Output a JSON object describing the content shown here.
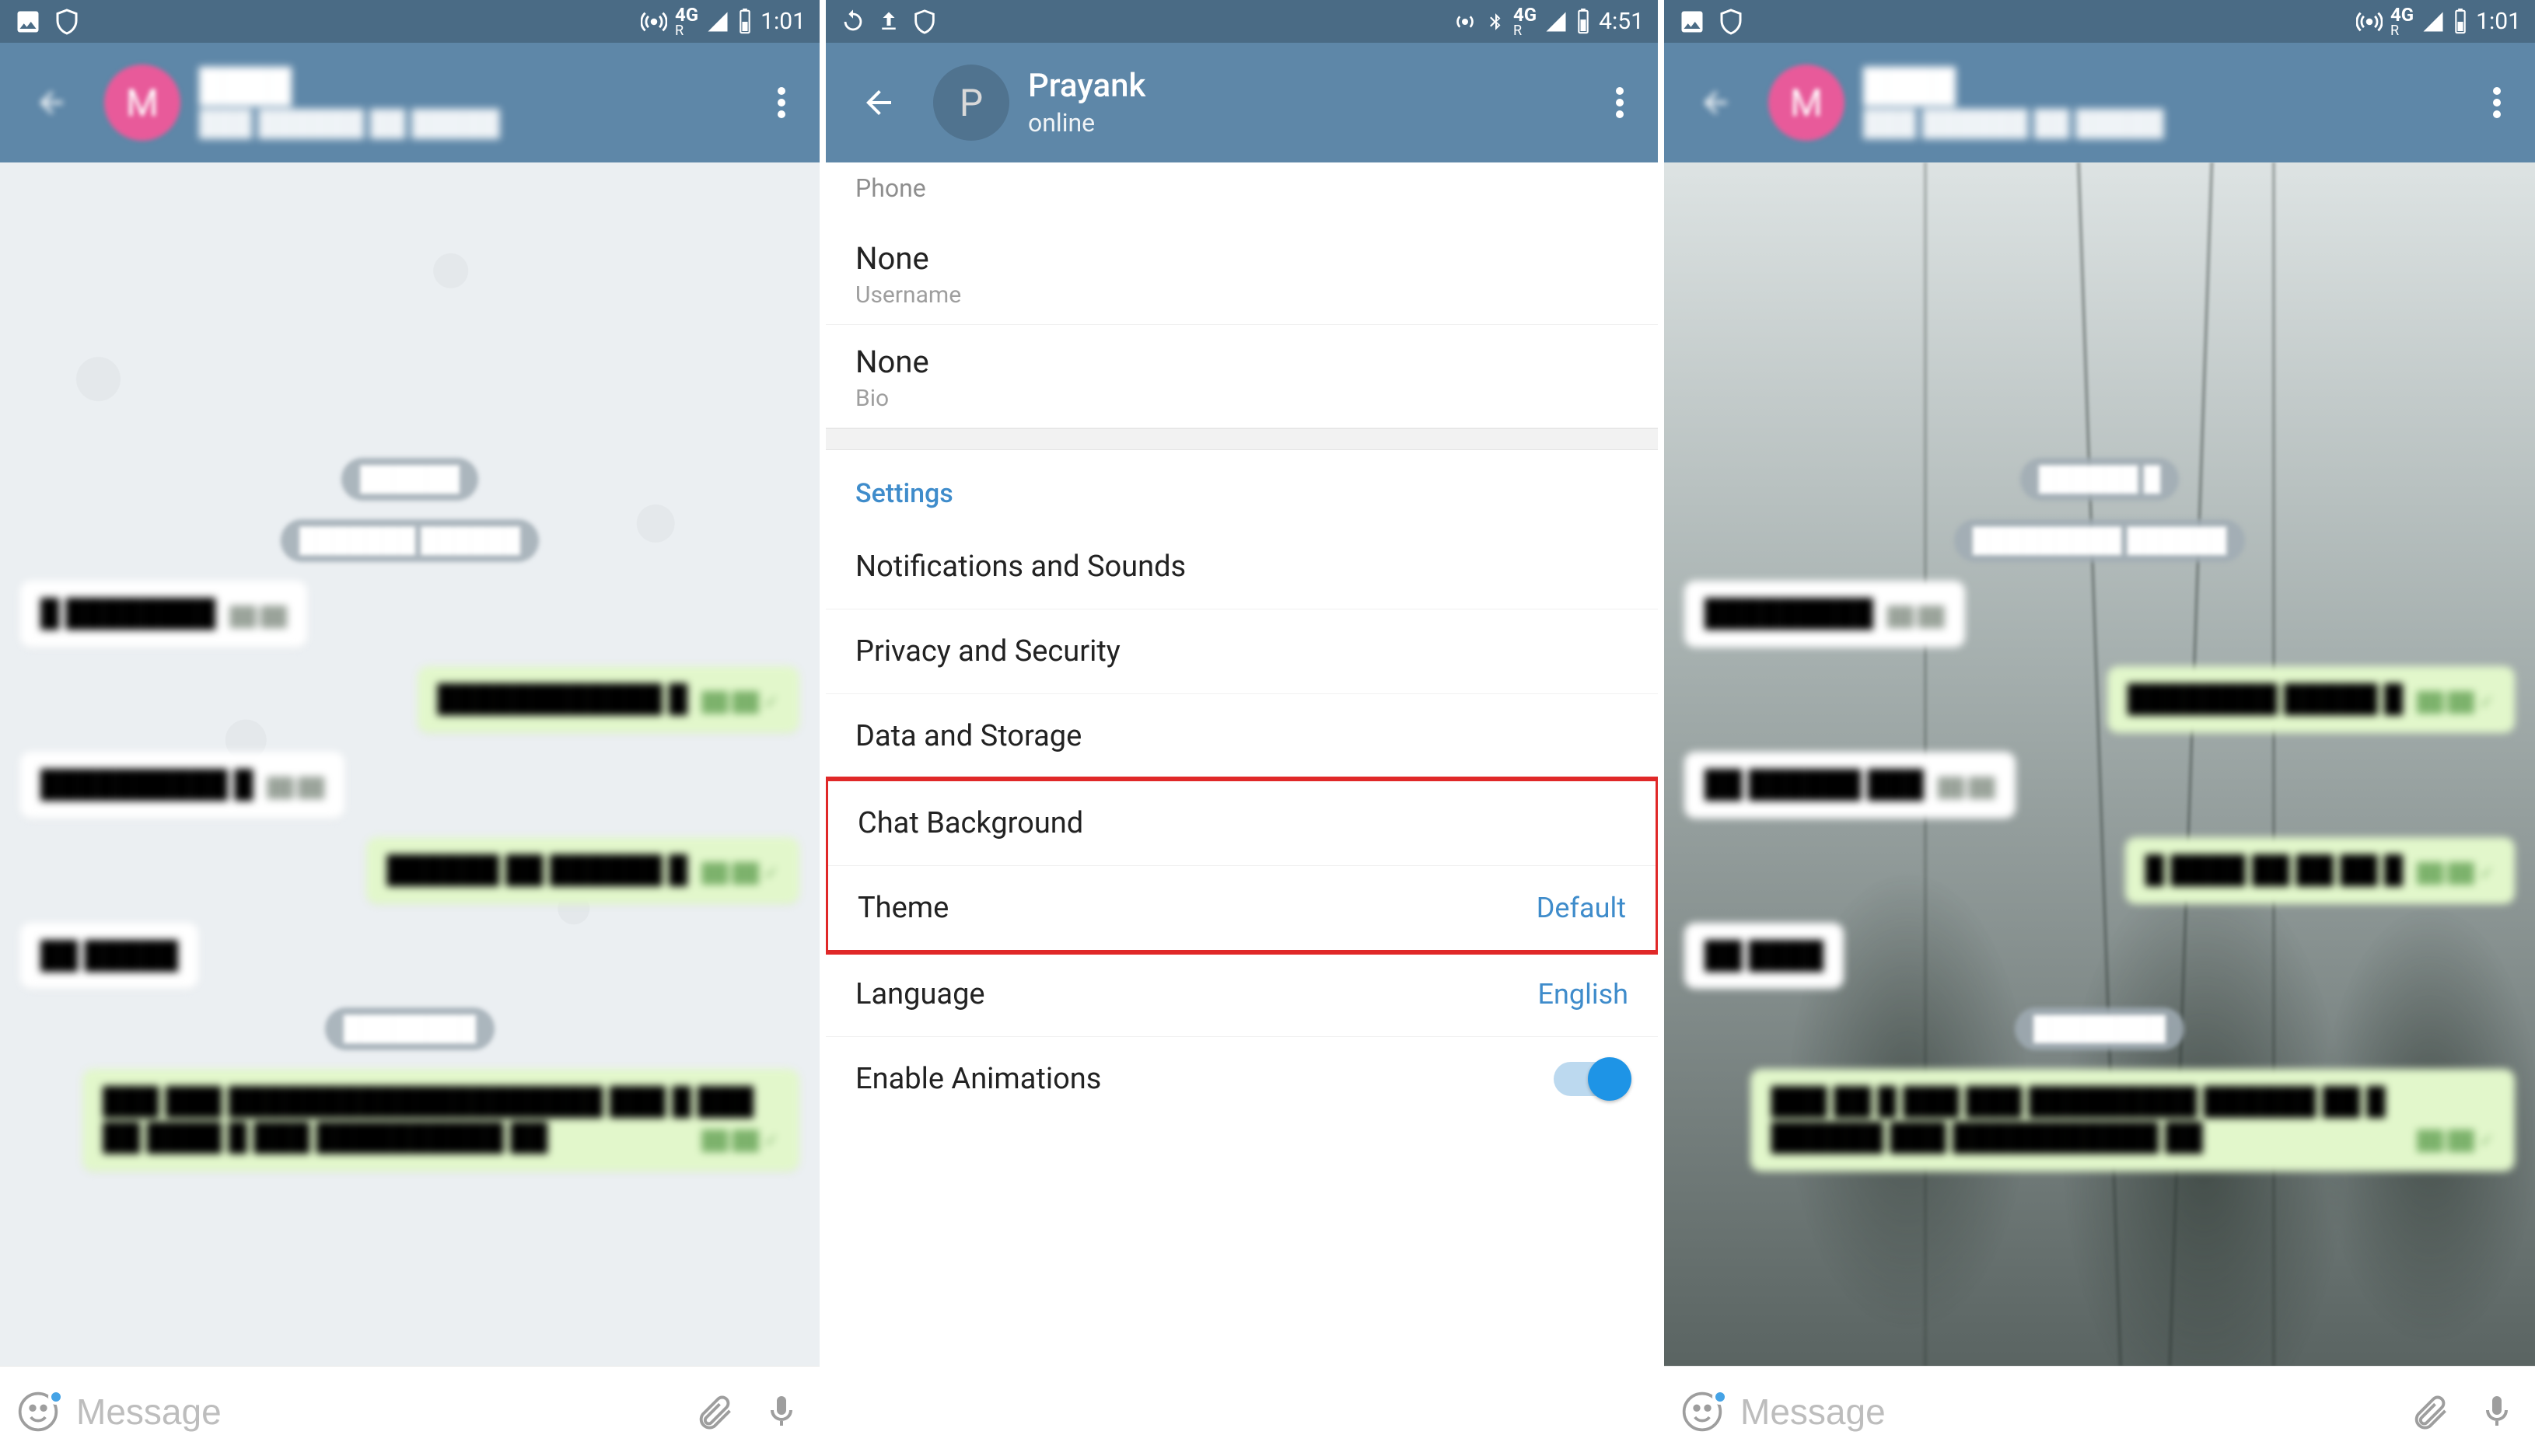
{
  "panels": {
    "left": {
      "status": {
        "time": "1:01",
        "net_label": "4G",
        "net_sub": "R"
      },
      "toolbar": {
        "title": "████",
        "subtitle": "███ ██████ ██ █████",
        "avatar_letter": "M"
      },
      "chat": {
        "chips": [
          "██████",
          "███████ ██████"
        ],
        "messages": [
          {
            "dir": "in",
            "text": "█ ████████",
            "ts": "██:██"
          },
          {
            "dir": "out",
            "text": "████████████ █",
            "ts": "██:██ ✓"
          },
          {
            "dir": "in",
            "text": "██████████ █",
            "ts": "██:██"
          },
          {
            "dir": "out",
            "text": "██████ ██ ██████ █",
            "ts": "██:██ ✓"
          },
          {
            "dir": "in",
            "text": "██ █████",
            "ts": ""
          }
        ],
        "service_chip": "████████",
        "long_out": "███ ███ ████████████████████ ███ █ ███ ██ ████ █ ███ ██████████ ██",
        "long_out_ts": "██:██ ✓"
      },
      "input_placeholder": "Message"
    },
    "mid": {
      "status": {
        "time": "4:51",
        "net_label": "4G",
        "net_sub": "R"
      },
      "toolbar": {
        "title": "Prayank",
        "subtitle": "online",
        "avatar_letter": "P"
      },
      "profile": [
        {
          "value": "",
          "label": "Phone",
          "value_hidden": true
        },
        {
          "value": "None",
          "label": "Username"
        },
        {
          "value": "None",
          "label": "Bio"
        }
      ],
      "settings_header": "Settings",
      "settings_rows": [
        {
          "label": "Notifications and Sounds"
        },
        {
          "label": "Privacy and Security"
        },
        {
          "label": "Data and Storage"
        },
        {
          "label": "Chat Background",
          "highlight": true
        },
        {
          "label": "Theme",
          "value": "Default",
          "highlight": true
        },
        {
          "label": "Language",
          "value": "English"
        },
        {
          "label": "Enable Animations",
          "toggle": true
        }
      ]
    },
    "right": {
      "status": {
        "time": "1:01",
        "net_label": "4G",
        "net_sub": "R"
      },
      "toolbar": {
        "title": "████",
        "subtitle": "███ ██████ ██ █████",
        "avatar_letter": "M"
      },
      "chat": {
        "chips": [
          "██████ █",
          "█████████ ██████"
        ],
        "messages": [
          {
            "dir": "in",
            "text": "█████████",
            "ts": "██:██"
          },
          {
            "dir": "out",
            "text": "████████ █████ █",
            "ts": "██:██ ✓"
          },
          {
            "dir": "in",
            "text": "██ ██████ ███",
            "ts": "██:██"
          },
          {
            "dir": "out",
            "text": "█ ████ ██ ██ ██ █",
            "ts": "██:██ ✓"
          },
          {
            "dir": "in",
            "text": "██ ████",
            "ts": ""
          }
        ],
        "service_chip": "████████",
        "long_out": "███ ██ █ ███ ███ █████████ ██████ ██ █ ██████ ███ ███████████ ██",
        "long_out_ts": "██:██ ✓"
      },
      "input_placeholder": "Message"
    }
  }
}
